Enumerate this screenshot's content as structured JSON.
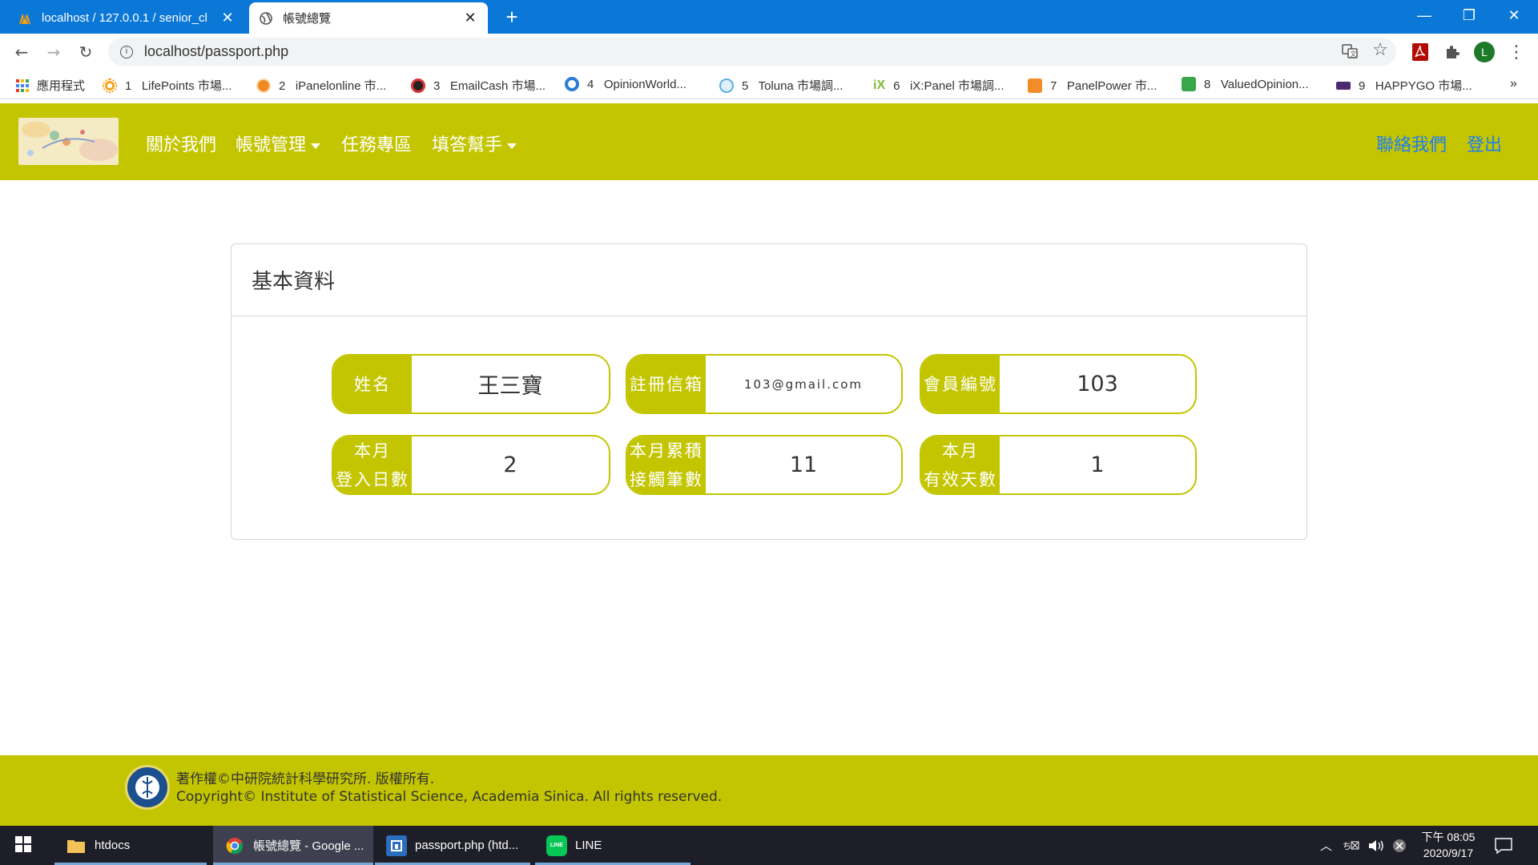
{
  "browser": {
    "tabs": [
      {
        "title": "localhost / 127.0.0.1 / senior_cl",
        "active": false
      },
      {
        "title": "帳號總覽",
        "active": true
      }
    ],
    "url": "localhost/passport.php",
    "profile_initial": "L",
    "bookmarks": [
      {
        "label": "應用程式",
        "icon": "apps-grid-icon"
      },
      {
        "label": "1   LifePoints 市場...",
        "icon": "lifepoints-icon"
      },
      {
        "label": "2   iPanelonline 市...",
        "icon": "ipanel-icon"
      },
      {
        "label": "3   EmailCash 市場...",
        "icon": "emailcash-icon"
      },
      {
        "label": "4   OpinionWorld...",
        "icon": "opinionworld-icon"
      },
      {
        "label": "5   Toluna 市場調...",
        "icon": "toluna-icon"
      },
      {
        "label": "6   iX:Panel 市場調...",
        "icon": "ixpanel-icon"
      },
      {
        "label": "7   PanelPower 市...",
        "icon": "panelpower-icon"
      },
      {
        "label": "8   ValuedOpinion...",
        "icon": "valuedopinion-icon"
      },
      {
        "label": "9   HAPPYGO 市場...",
        "icon": "happygo-icon"
      }
    ],
    "bookmarks_more": "»"
  },
  "site_nav": {
    "links": [
      "關於我們",
      "帳號管理",
      "任務專區",
      "填答幫手"
    ],
    "right_links": [
      "聯絡我們",
      "登出"
    ]
  },
  "card": {
    "title": "基本資料",
    "row1": [
      {
        "label": "姓名",
        "value": "王三寶"
      },
      {
        "label": "註冊信箱",
        "value": "103@gmail.com"
      },
      {
        "label": "會員編號",
        "value": "103"
      }
    ],
    "row2": [
      {
        "label_l1": "本月",
        "label_l2": "登入日數",
        "value": "2"
      },
      {
        "label_l1": "本月累積",
        "label_l2": "接觸筆數",
        "value": "11"
      },
      {
        "label_l1": "本月",
        "label_l2": "有效天數",
        "value": "1"
      }
    ]
  },
  "footer": {
    "line1": "著作權©中研院統計科學研究所. 版權所有.",
    "line2": "Copyright© Institute of Statistical Science, Academia Sinica. All rights reserved."
  },
  "taskbar": {
    "items": [
      "htdocs",
      "帳號總覽 - Google ...",
      "passport.php (htd...",
      "LINE"
    ],
    "time": "下午 08:05",
    "date": "2020/9/17"
  },
  "colors": {
    "theme": "#c3c500",
    "chrome_blue": "#0b78d7",
    "link_blue": "#1e7ef0"
  }
}
